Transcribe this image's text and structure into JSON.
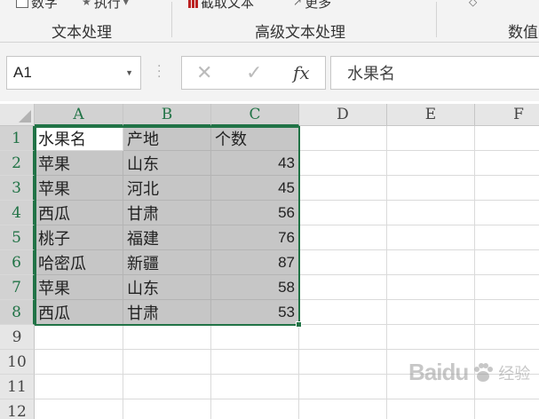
{
  "ribbon": {
    "items": [
      {
        "label": "数字",
        "icon": "checkbox-icon"
      },
      {
        "label": "执行",
        "icon": "run-icon"
      },
      {
        "label": "截取文本",
        "icon": "bars-icon"
      },
      {
        "label": "更多",
        "icon": "arrow-icon"
      }
    ],
    "groups": [
      "文本处理",
      "高级文本处理",
      "数值"
    ]
  },
  "formula_bar": {
    "name_box": "A1",
    "cancel_symbol": "✕",
    "enter_symbol": "✓",
    "fx_label": "fx",
    "content": "水果名"
  },
  "columns": [
    "A",
    "B",
    "C",
    "D",
    "E",
    "F"
  ],
  "selected_columns": [
    "A",
    "B",
    "C"
  ],
  "rows": [
    "1",
    "2",
    "3",
    "4",
    "5",
    "6",
    "7",
    "8",
    "9",
    "10",
    "11",
    "12"
  ],
  "selected_rows": [
    "1",
    "2",
    "3",
    "4",
    "5",
    "6",
    "7",
    "8"
  ],
  "active_cell": "A1",
  "table": {
    "headers": [
      "水果名",
      "产地",
      "个数"
    ],
    "data": [
      [
        "苹果",
        "山东",
        "43"
      ],
      [
        "苹果",
        "河北",
        "45"
      ],
      [
        "西瓜",
        "甘肃",
        "56"
      ],
      [
        "桃子",
        "福建",
        "76"
      ],
      [
        "哈密瓜",
        "新疆",
        "87"
      ],
      [
        "苹果",
        "山东",
        "58"
      ],
      [
        "西瓜",
        "甘肃",
        "53"
      ]
    ]
  },
  "watermark": {
    "brand": "Baidu",
    "sub": "经验"
  },
  "colors": {
    "accent": "#217346",
    "selection_fill": "#c6c6c6",
    "header_bg": "#e6e6e6"
  }
}
